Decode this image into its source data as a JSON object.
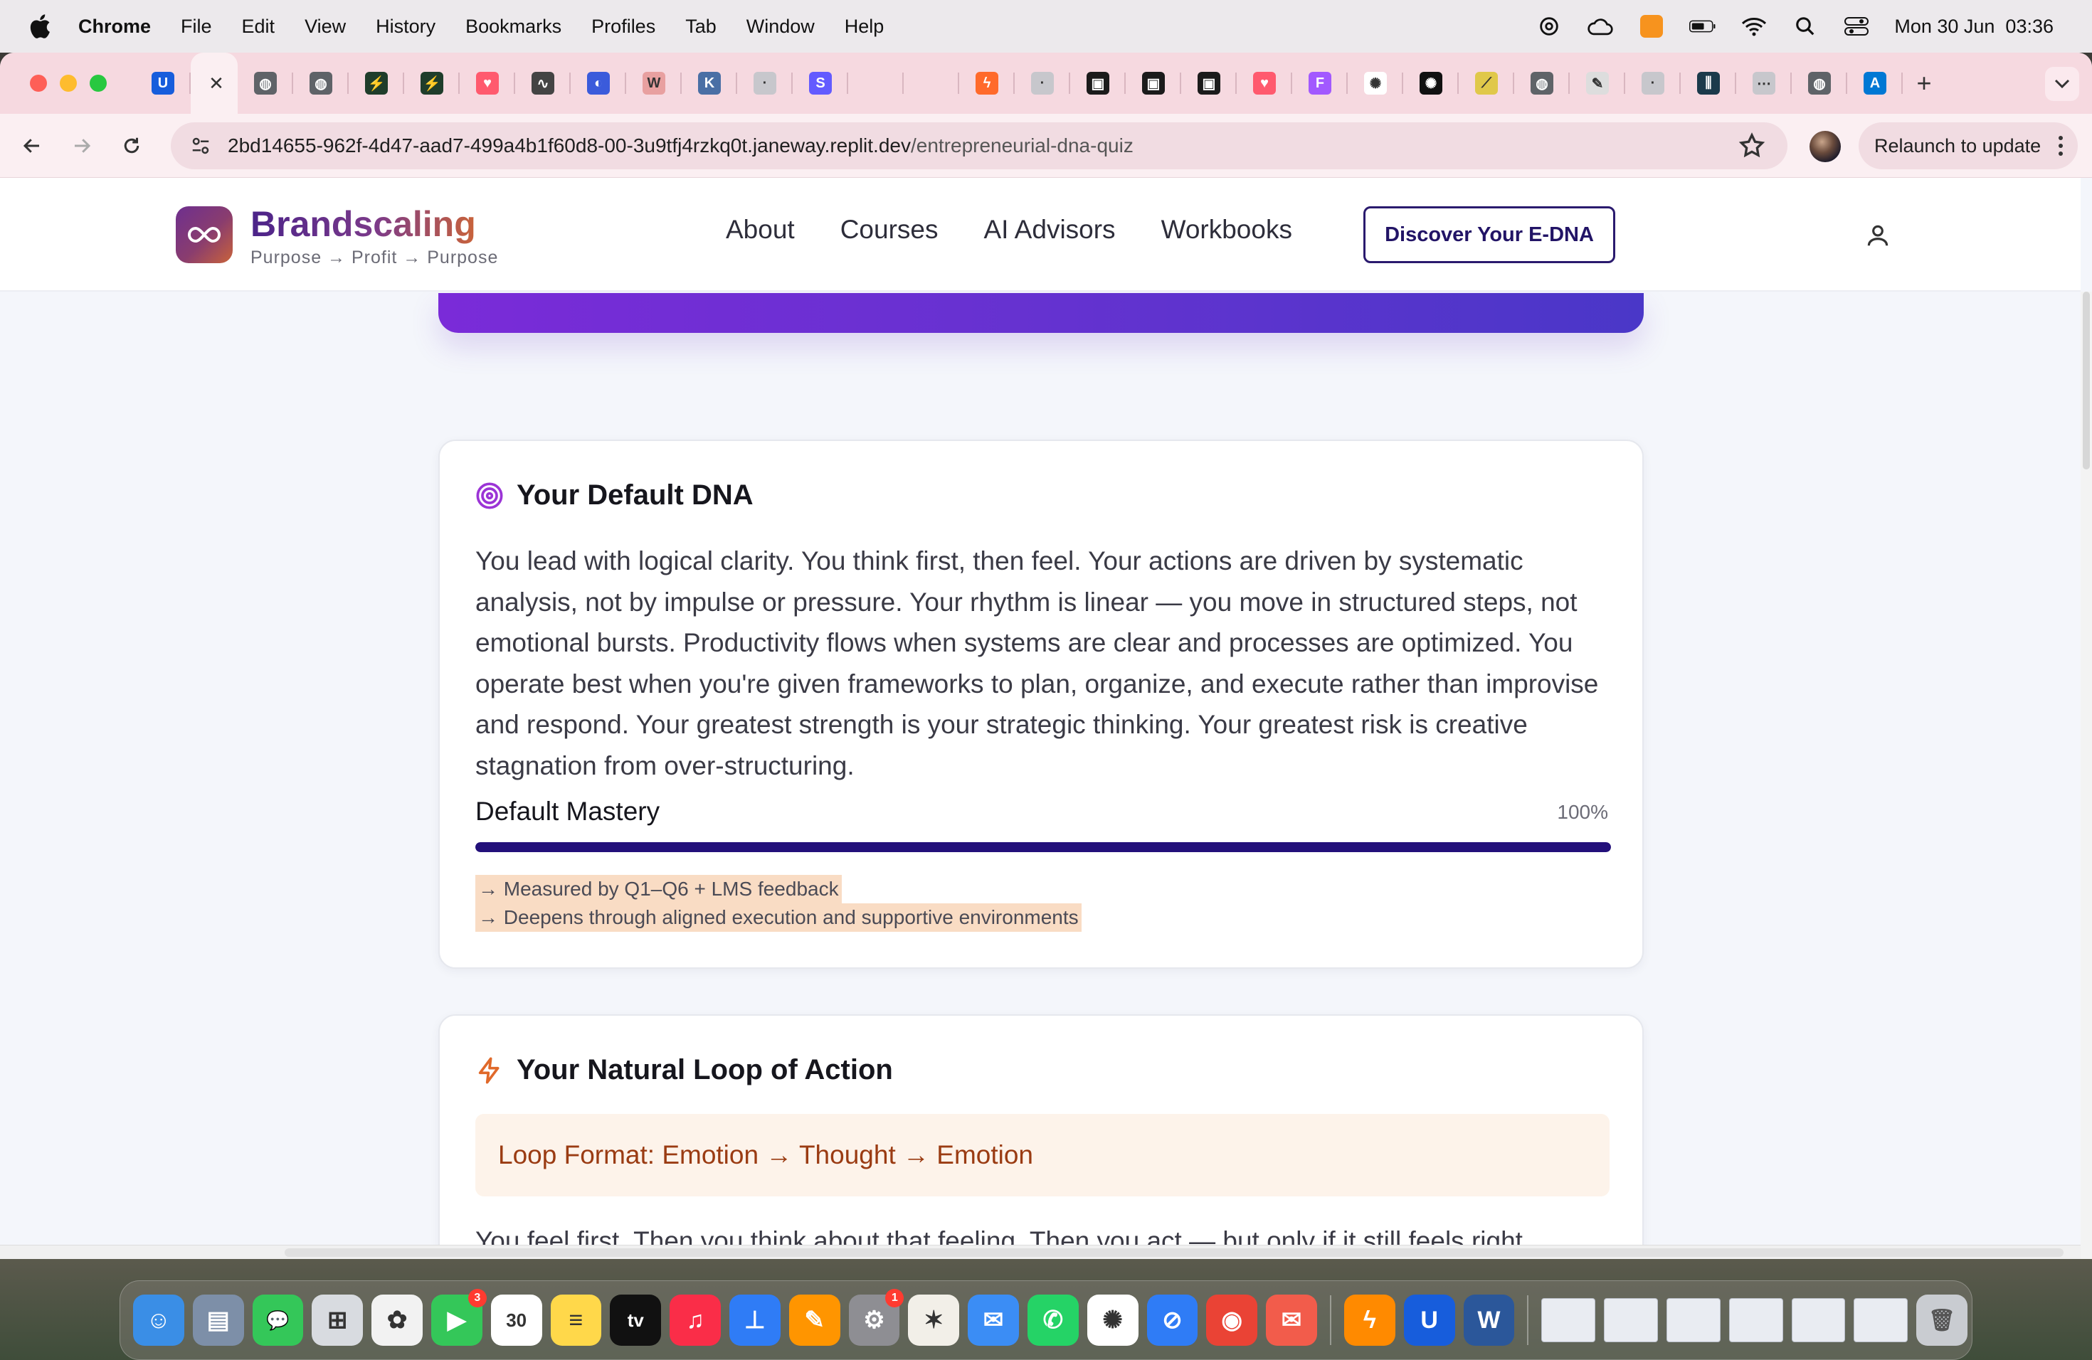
{
  "menubar": {
    "items": [
      "Chrome",
      "File",
      "Edit",
      "View",
      "History",
      "Bookmarks",
      "Profiles",
      "Tab",
      "Window",
      "Help"
    ],
    "clock": "Mon 30 Jun  03:36",
    "status_icons": [
      "chatgpt-icon",
      "cloud-icon",
      "vpn-icon",
      "battery-icon",
      "wifi-icon",
      "search-icon",
      "control-center-icon"
    ]
  },
  "browser": {
    "tabs": [
      {
        "icon": "bitwarden-icon",
        "color": "#175ddc",
        "glyph": "U"
      },
      {
        "icon": "replit-icon",
        "color": "#f26207",
        "glyph": "⠿",
        "active": true
      },
      {
        "icon": "globe-icon",
        "color": "#5f6368",
        "glyph": "◍"
      },
      {
        "icon": "globe-icon",
        "color": "#5f6368",
        "glyph": "◍"
      },
      {
        "icon": "bolt-icon",
        "color": "#1f3d2b",
        "glyph": "⚡"
      },
      {
        "icon": "bolt-icon",
        "color": "#1f3d2b",
        "glyph": "⚡"
      },
      {
        "icon": "lovable-icon",
        "color": "#ff5a6e",
        "glyph": "♥"
      },
      {
        "icon": "pulse-icon",
        "color": "#444444",
        "glyph": "∿"
      },
      {
        "icon": "pill-icon",
        "color": "#3b5bdb",
        "glyph": "◐"
      },
      {
        "icon": "wp-icon",
        "color": "#e8a0a0",
        "glyph": "W"
      },
      {
        "icon": "k-icon",
        "color": "#4a6fa5",
        "glyph": "K"
      },
      {
        "icon": "site-icon",
        "color": "#c7c7cc",
        "glyph": "·"
      },
      {
        "icon": "s-icon",
        "color": "#635bff",
        "glyph": "S"
      },
      {
        "icon": "blank-icon",
        "color": "#f6d9e0",
        "glyph": ""
      },
      {
        "icon": "blank-icon",
        "color": "#f6d9e0",
        "glyph": ""
      },
      {
        "icon": "flame-icon",
        "color": "#ff6a2b",
        "glyph": "ϟ"
      },
      {
        "icon": "site-icon",
        "color": "#c7c7cc",
        "glyph": "·"
      },
      {
        "icon": "vimeo-icon",
        "color": "#1b1b1b",
        "glyph": "▣"
      },
      {
        "icon": "vimeo-icon",
        "color": "#1b1b1b",
        "glyph": "▣"
      },
      {
        "icon": "vimeo-icon",
        "color": "#1b1b1b",
        "glyph": "▣"
      },
      {
        "icon": "lovable-icon",
        "color": "#ff5a6e",
        "glyph": "♥"
      },
      {
        "icon": "figma-icon",
        "color": "#a259ff",
        "glyph": "F"
      },
      {
        "icon": "openai-icon",
        "color": "#ffffff",
        "glyph": "✺"
      },
      {
        "icon": "openai-icon",
        "color": "#111111",
        "glyph": "✺"
      },
      {
        "icon": "cursor-icon",
        "color": "#e0c84a",
        "glyph": "⟋"
      },
      {
        "icon": "globe-icon",
        "color": "#5f6368",
        "glyph": "◍"
      },
      {
        "icon": "pen-icon",
        "color": "#dddddd",
        "glyph": "✎"
      },
      {
        "icon": "site-icon",
        "color": "#c7c7cc",
        "glyph": "·"
      },
      {
        "icon": "chart-icon",
        "color": "#1b3a4b",
        "glyph": "⫼"
      },
      {
        "icon": "grid-icon",
        "color": "#c7c7cc",
        "glyph": "⋯"
      },
      {
        "icon": "globe-icon",
        "color": "#5f6368",
        "glyph": "◍"
      },
      {
        "icon": "azure-icon",
        "color": "#0078d4",
        "glyph": "A"
      }
    ],
    "url_host": "2bd14655-962f-4d47-aad7-499a4b1f60d8-00-3u9tfj4rzkq0t.janeway.replit.dev",
    "url_path": "/entrepreneurial-dna-quiz",
    "relaunch_label": "Relaunch to update"
  },
  "site": {
    "brand_name": "Brandscaling",
    "tagline": "Purpose → Profit → Purpose",
    "nav": [
      "About",
      "Courses",
      "AI Advisors",
      "Workbooks"
    ],
    "cta_label": "Discover Your E-DNA"
  },
  "default_dna": {
    "title": "Your Default DNA",
    "description": "You lead with logical clarity. You think first, then feel. Your actions are driven by systematic analysis, not by impulse or pressure. Your rhythm is linear — you move in structured steps, not emotional bursts. Productivity flows when systems are clear and processes are optimized. You operate best when you're given frameworks to plan, organize, and execute rather than improvise and respond. Your greatest strength is your strategic thinking. Your greatest risk is creative stagnation from over-structuring.",
    "mastery_label": "Default Mastery",
    "mastery_value_text": "100%",
    "mastery_fraction": 1.0,
    "notes": [
      "→ Measured by Q1–Q6 + LMS feedback",
      "→ Deepens through aligned execution and supportive environments"
    ]
  },
  "natural_loop": {
    "title": "Your Natural Loop of Action",
    "format": "Loop Format: Emotion → Thought → Emotion",
    "description": "You feel first. Then you think about that feeling. Then you act — but only if it still feels right."
  },
  "dock": {
    "apps": [
      {
        "name": "finder-icon",
        "color": "#3a8ee6",
        "glyph": "☺"
      },
      {
        "name": "preview-icon",
        "color": "#7d8fa8",
        "glyph": "▤"
      },
      {
        "name": "messages-icon",
        "color": "#34c759",
        "glyph": "💬"
      },
      {
        "name": "launchpad-icon",
        "color": "#d8dbe0",
        "glyph": "⊞"
      },
      {
        "name": "photos-icon",
        "color": "#f2f2f2",
        "glyph": "✿"
      },
      {
        "name": "facetime-icon",
        "color": "#34c759",
        "glyph": "▶",
        "badge": "3"
      },
      {
        "name": "calendar-icon",
        "color": "#ffffff",
        "glyph": "30"
      },
      {
        "name": "notes-icon",
        "color": "#ffd84a",
        "glyph": "≡"
      },
      {
        "name": "tv-icon",
        "color": "#111111",
        "glyph": "tv"
      },
      {
        "name": "music-icon",
        "color": "#fa2d48",
        "glyph": "♫"
      },
      {
        "name": "keynote-icon",
        "color": "#2f7cf6",
        "glyph": "⊥"
      },
      {
        "name": "pages-icon",
        "color": "#ff9500",
        "glyph": "✎"
      },
      {
        "name": "settings-icon",
        "color": "#8e8e93",
        "glyph": "⚙",
        "badge": "1"
      },
      {
        "name": "claude-icon",
        "color": "#f2efe8",
        "glyph": "✶"
      },
      {
        "name": "mail-icon",
        "color": "#3b8df5",
        "glyph": "✉"
      },
      {
        "name": "whatsapp-icon",
        "color": "#25d366",
        "glyph": "✆"
      },
      {
        "name": "chatgpt-icon",
        "color": "#ffffff",
        "glyph": "✺"
      },
      {
        "name": "safari-icon",
        "color": "#2f7cf6",
        "glyph": "⊘"
      },
      {
        "name": "chrome-icon",
        "color": "#ea4335",
        "glyph": "◉"
      },
      {
        "name": "airmail-icon",
        "color": "#f25c4b",
        "glyph": "✉"
      }
    ],
    "apps_right": [
      {
        "name": "uplink-icon",
        "color": "#ff8a00",
        "glyph": "ϟ"
      },
      {
        "name": "bitwarden-icon",
        "color": "#175ddc",
        "glyph": "U"
      },
      {
        "name": "word-icon",
        "color": "#2b579a",
        "glyph": "W"
      }
    ],
    "window_thumbs": 6
  }
}
